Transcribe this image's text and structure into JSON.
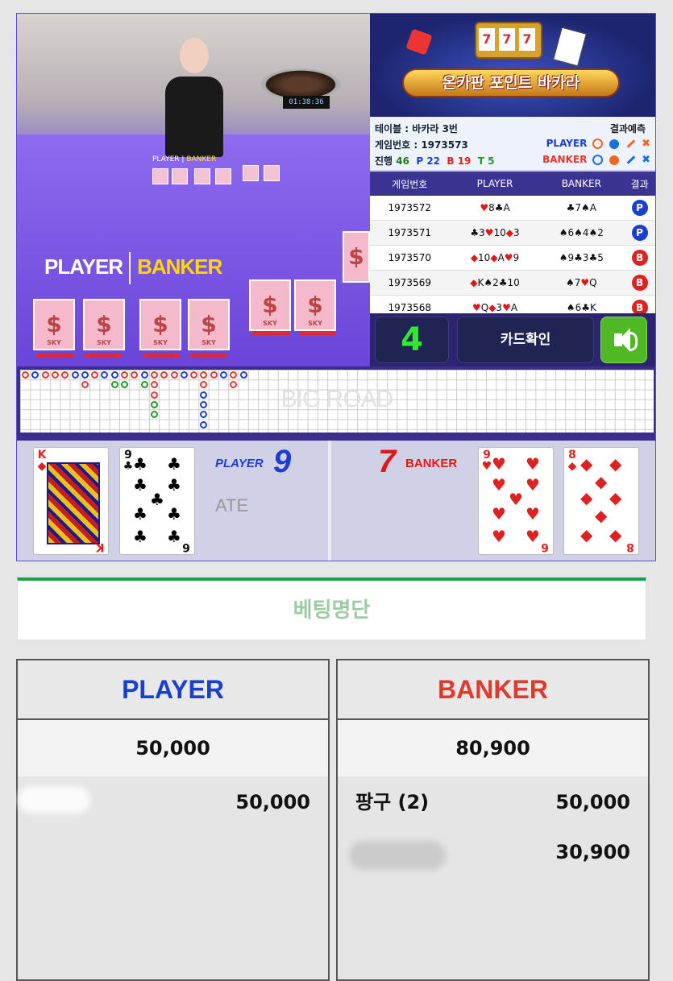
{
  "video": {
    "timer": "01:38:36",
    "table_label_player": "PLAYER",
    "table_label_banker": "BANKER",
    "overlay_player": "PLAYER",
    "overlay_banker": "BANKER",
    "card_back_text": "SKY"
  },
  "info": {
    "banner_title": "온카판 포인트 바카라",
    "slot_reels": [
      "7",
      "7",
      "7"
    ],
    "table_name": "테이블 : 바카라 3번",
    "game_number": "게임번호 : 1973573",
    "progress_label": "진행",
    "progress_count": "46",
    "p_count": "P 22",
    "b_count": "B 19",
    "t_count": "T 5",
    "prediction_title": "결과예측",
    "prediction_player": "PLAYER",
    "prediction_banker": "BANKER",
    "colors": {
      "player": "#1a3fcf",
      "banker": "#e03a2e",
      "tie": "#1f9b1f",
      "accent_bg": "#3b3392"
    }
  },
  "history": {
    "headers": [
      "게임번호",
      "PLAYER",
      "BANKER",
      "결과"
    ],
    "rows": [
      {
        "no": "1973572",
        "player": [
          {
            "s": "♥",
            "v": "8",
            "c": "r"
          },
          {
            "s": "♣",
            "v": "A",
            "c": "k"
          }
        ],
        "banker": [
          {
            "s": "♣",
            "v": "7",
            "c": "k"
          },
          {
            "s": "♠",
            "v": "A",
            "c": "k"
          }
        ],
        "result": "P"
      },
      {
        "no": "1973571",
        "player": [
          {
            "s": "♣",
            "v": "3",
            "c": "k"
          },
          {
            "s": "♥",
            "v": "10",
            "c": "r"
          },
          {
            "s": "◆",
            "v": "3",
            "c": "r"
          }
        ],
        "banker": [
          {
            "s": "♠",
            "v": "6",
            "c": "k"
          },
          {
            "s": "♠",
            "v": "4",
            "c": "k"
          },
          {
            "s": "♠",
            "v": "2",
            "c": "k"
          }
        ],
        "result": "P"
      },
      {
        "no": "1973570",
        "player": [
          {
            "s": "◆",
            "v": "10",
            "c": "r"
          },
          {
            "s": "◆",
            "v": "A",
            "c": "r"
          },
          {
            "s": "♥",
            "v": "9",
            "c": "r"
          }
        ],
        "banker": [
          {
            "s": "♠",
            "v": "9",
            "c": "k"
          },
          {
            "s": "♣",
            "v": "3",
            "c": "k"
          },
          {
            "s": "♣",
            "v": "5",
            "c": "k"
          }
        ],
        "result": "B"
      },
      {
        "no": "1973569",
        "player": [
          {
            "s": "◆",
            "v": "K",
            "c": "r"
          },
          {
            "s": "♠",
            "v": "2",
            "c": "k"
          },
          {
            "s": "♣",
            "v": "10",
            "c": "k"
          }
        ],
        "banker": [
          {
            "s": "♠",
            "v": "7",
            "c": "k"
          },
          {
            "s": "♥",
            "v": "Q",
            "c": "r"
          }
        ],
        "result": "B"
      },
      {
        "no": "1973568",
        "player": [
          {
            "s": "♥",
            "v": "Q",
            "c": "r"
          },
          {
            "s": "◆",
            "v": "3",
            "c": "r"
          },
          {
            "s": "♥",
            "v": "A",
            "c": "r"
          }
        ],
        "banker": [
          {
            "s": "♠",
            "v": "6",
            "c": "k"
          },
          {
            "s": "♣",
            "v": "K",
            "c": "k"
          }
        ],
        "result": "B"
      }
    ]
  },
  "controls": {
    "countdown": "4",
    "check_cards": "카드확인",
    "sound_icon": "speaker-icon"
  },
  "bigroad": {
    "label": "BIG ROAD"
  },
  "reveal": {
    "player_label": "PLAYER",
    "player_score": "9",
    "banker_label": "BANKER",
    "banker_score": "7",
    "tie_fragment": "ATE",
    "player_cards": [
      {
        "rank": "K",
        "suit": "◆",
        "color": "red"
      },
      {
        "rank": "9",
        "suit": "♣",
        "color": "black"
      }
    ],
    "banker_cards": [
      {
        "rank": "9",
        "suit": "♥",
        "color": "red"
      },
      {
        "rank": "8",
        "suit": "◆",
        "color": "red"
      }
    ],
    "banker_third_corner": "6"
  },
  "bets": {
    "section_title": "베팅명단",
    "player": {
      "title": "PLAYER",
      "total": "50,000",
      "lines": [
        {
          "name": "",
          "amount": "50,000"
        }
      ]
    },
    "banker": {
      "title": "BANKER",
      "total": "80,900",
      "lines": [
        {
          "name": "팡구 (2)",
          "amount": "50,000"
        },
        {
          "name": "",
          "amount": "30,900"
        }
      ]
    }
  }
}
